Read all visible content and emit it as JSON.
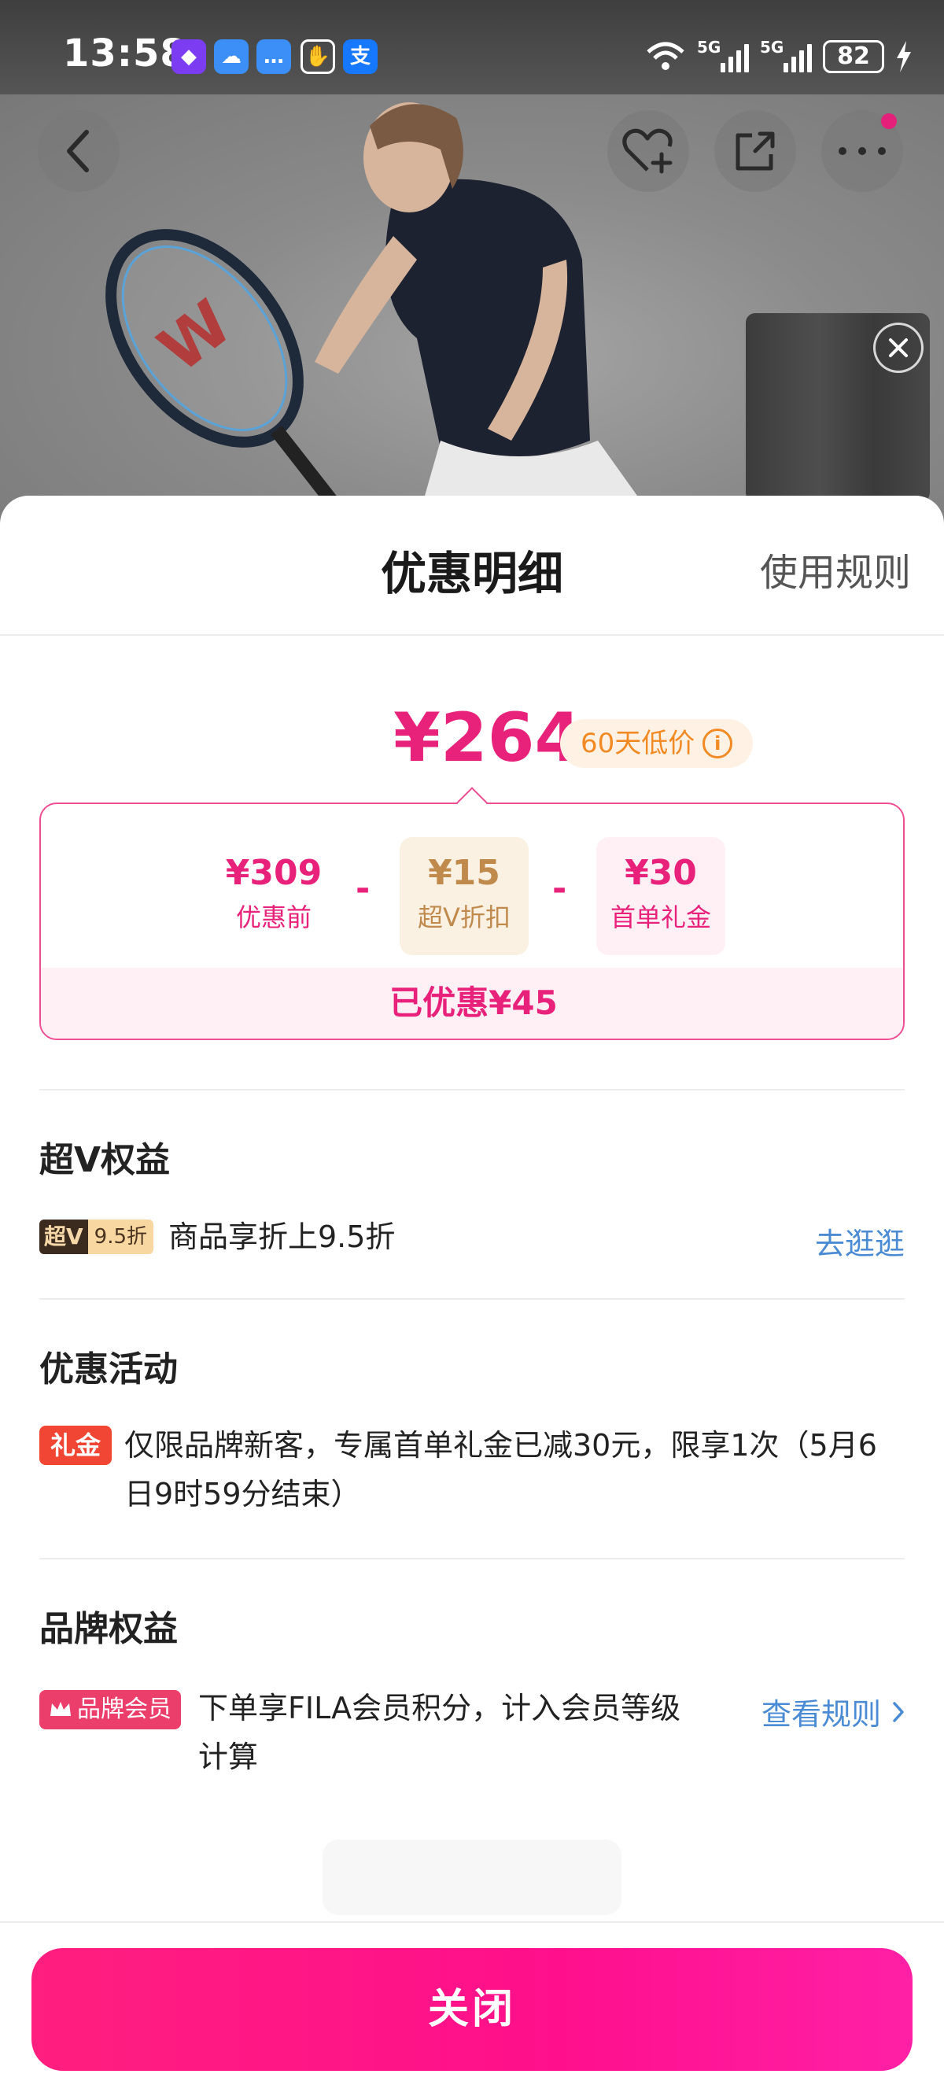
{
  "status_bar": {
    "time": "13:58",
    "network_1": "5G",
    "network_2": "5G",
    "battery": "82"
  },
  "sheet": {
    "title": "优惠明细",
    "rules_link": "使用规则",
    "final_price": "¥264",
    "low_price_badge": "60天低价",
    "breakdown": [
      {
        "amount": "¥309",
        "label": "优惠前"
      },
      {
        "amount": "¥15",
        "label": "超V折扣"
      },
      {
        "amount": "¥30",
        "label": "首单礼金"
      }
    ],
    "saved_text": "已优惠¥45"
  },
  "sections": {
    "super_v": {
      "title": "超V权益",
      "tag_a": "超V",
      "tag_b": "9.5折",
      "text": "商品享折上9.5折",
      "link": "去逛逛"
    },
    "promo": {
      "title": "优惠活动",
      "tag": "礼金",
      "text_line1": "仅限品牌新客，专属首单礼金已减30元，限享1次（5月6",
      "text_line2": "日9时59分结束）"
    },
    "brand": {
      "title": "品牌权益",
      "tag": "品牌会员",
      "text_line1": "下单享FILA会员积分，计入会员等级",
      "text_line2": "计算",
      "link": "查看规则"
    }
  },
  "close_button": "关闭",
  "colors": {
    "accent": "#e8217a",
    "link": "#4b8bd3",
    "badge_bg": "#fff1e4",
    "badge_text": "#f28a23"
  }
}
